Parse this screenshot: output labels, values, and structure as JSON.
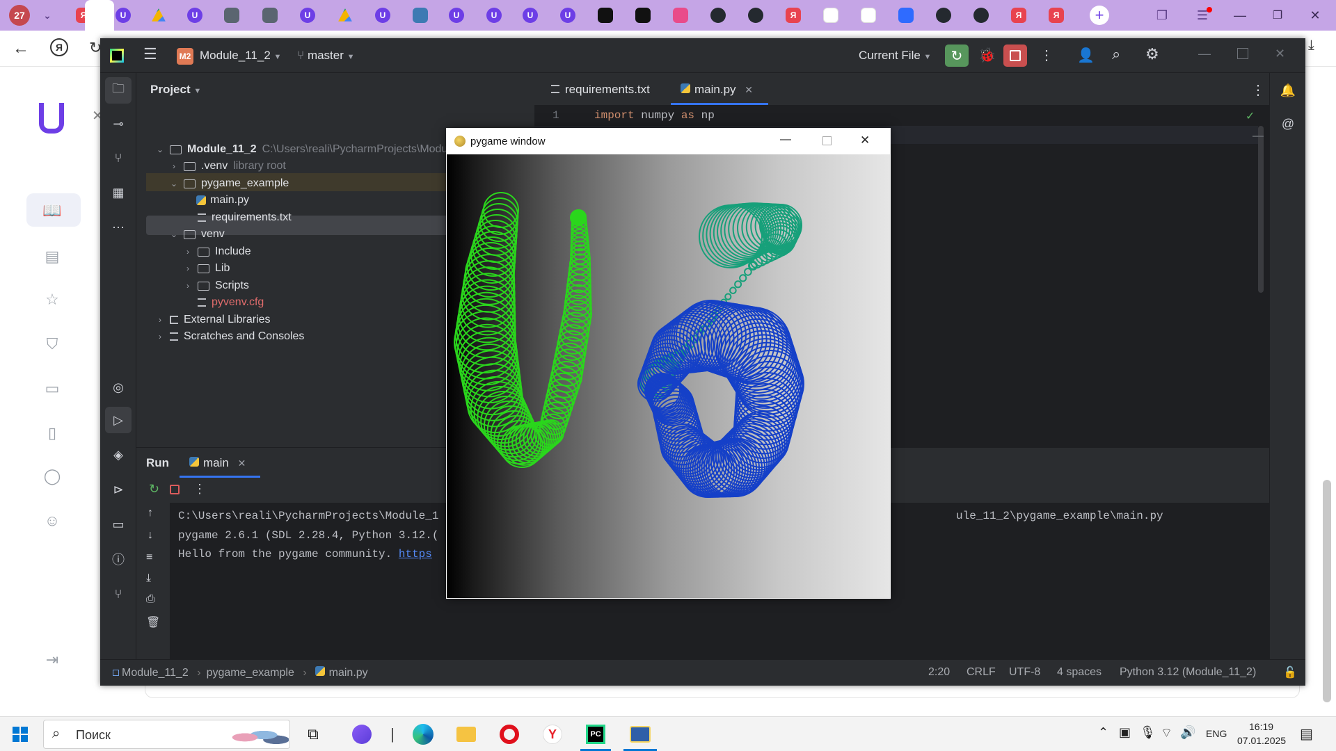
{
  "browser": {
    "counter_badge": "27",
    "tabs": [
      {
        "icon": "yandex-icon",
        "color": "#e8434f"
      },
      {
        "icon": "brand-u-icon",
        "color": "#6d3ee6"
      },
      {
        "icon": "google-drive-icon",
        "color": "#f4b400"
      },
      {
        "icon": "brand-u-icon",
        "color": "#6d3ee6"
      },
      {
        "icon": "column-icon",
        "color": "#5a6570"
      },
      {
        "icon": "book-icon",
        "color": "#5a6570"
      },
      {
        "icon": "brand-u-icon",
        "color": "#6d3ee6"
      },
      {
        "icon": "google-drive-icon",
        "color": "#f4b400"
      },
      {
        "icon": "brand-u-icon",
        "color": "#6d3ee6"
      },
      {
        "icon": "python-icon",
        "color": "#3d7ab3"
      },
      {
        "icon": "brand-u-icon",
        "color": "#6d3ee6"
      },
      {
        "icon": "brand-u-icon",
        "color": "#6d3ee6"
      },
      {
        "icon": "brand-u-icon",
        "color": "#6d3ee6"
      },
      {
        "icon": "brand-u-icon",
        "color": "#6d3ee6"
      },
      {
        "icon": "kinopoisk-icon",
        "color": "#111111"
      },
      {
        "icon": "kinopoisk-icon",
        "color": "#111111"
      },
      {
        "icon": "brand-badge-icon",
        "color": "#e94b8a"
      },
      {
        "icon": "github-icon",
        "color": "#24292f"
      },
      {
        "icon": "github-icon",
        "color": "#24292f"
      },
      {
        "icon": "yandex-icon",
        "color": "#e8434f"
      },
      {
        "icon": "cube-icon",
        "color": "#ffffff"
      },
      {
        "icon": "cube-icon",
        "color": "#ffffff"
      },
      {
        "icon": "chat-icon",
        "color": "#2f6bff"
      },
      {
        "icon": "github-icon",
        "color": "#24292f"
      },
      {
        "icon": "github-icon",
        "color": "#24292f"
      },
      {
        "icon": "yandex-icon",
        "color": "#e8434f"
      },
      {
        "icon": "yandex-icon",
        "color": "#e8434f"
      }
    ],
    "yandex_letter": "Я",
    "github_letter": "⌥",
    "u_letter": "U"
  },
  "ide": {
    "project_badge": "M2",
    "project_name": "Module_11_2",
    "branch": "master",
    "run_config": "Current File",
    "project_panel_title": "Project",
    "tree": [
      {
        "label": "Module_11_2",
        "hint": "C:\\Users\\reali\\PycharmProjects\\Module_11_2",
        "type": "root"
      },
      {
        "label": ".venv",
        "hint": "library root",
        "type": "folder"
      },
      {
        "label": "pygame_example",
        "hint": "",
        "type": "folder-open"
      },
      {
        "label": "main.py",
        "hint": "",
        "type": "py"
      },
      {
        "label": "requirements.txt",
        "hint": "",
        "type": "txt"
      },
      {
        "label": "venv",
        "hint": "",
        "type": "folder-open"
      },
      {
        "label": "Include",
        "hint": "",
        "type": "folder"
      },
      {
        "label": "Lib",
        "hint": "",
        "type": "folder"
      },
      {
        "label": "Scripts",
        "hint": "",
        "type": "folder"
      },
      {
        "label": "pyvenv.cfg",
        "hint": "",
        "type": "cfg"
      },
      {
        "label": "External Libraries",
        "hint": "",
        "type": "lib"
      },
      {
        "label": "Scratches and Consoles",
        "hint": "",
        "type": "scratch"
      }
    ],
    "editor_tabs": [
      {
        "label": "requirements.txt"
      },
      {
        "label": "main.py"
      }
    ],
    "code_line_number": "1",
    "code_kw1": "import",
    "code_mod": " numpy ",
    "code_kw2": "as",
    "code_alias": " np",
    "run_title": "Run",
    "run_tab": "main",
    "console": {
      "line1_left": "C:\\Users\\reali\\PycharmProjects\\Module_1",
      "line1_right": "ule_11_2\\pygame_example\\main.py",
      "line2": "pygame 2.6.1 (SDL 2.28.4, Python 3.12.(",
      "line3_text": "Hello from the pygame community. ",
      "line3_link": "https"
    },
    "status": {
      "crumb1": "Module_11_2",
      "crumb2": "pygame_example",
      "crumb3": "main.py",
      "position": "2:20",
      "line_sep": "CRLF",
      "encoding": "UTF-8",
      "indent": "4 spaces",
      "interpreter": "Python 3.12 (Module_11_2)"
    }
  },
  "pygame": {
    "title": "pygame window",
    "colors": {
      "green": "#2ad61c",
      "teal": "#17a07a",
      "blue": "#1540c8"
    }
  },
  "taskbar": {
    "search_label": "Поиск",
    "lang": "ENG",
    "time": "16:19",
    "date": "07.01.2025"
  }
}
